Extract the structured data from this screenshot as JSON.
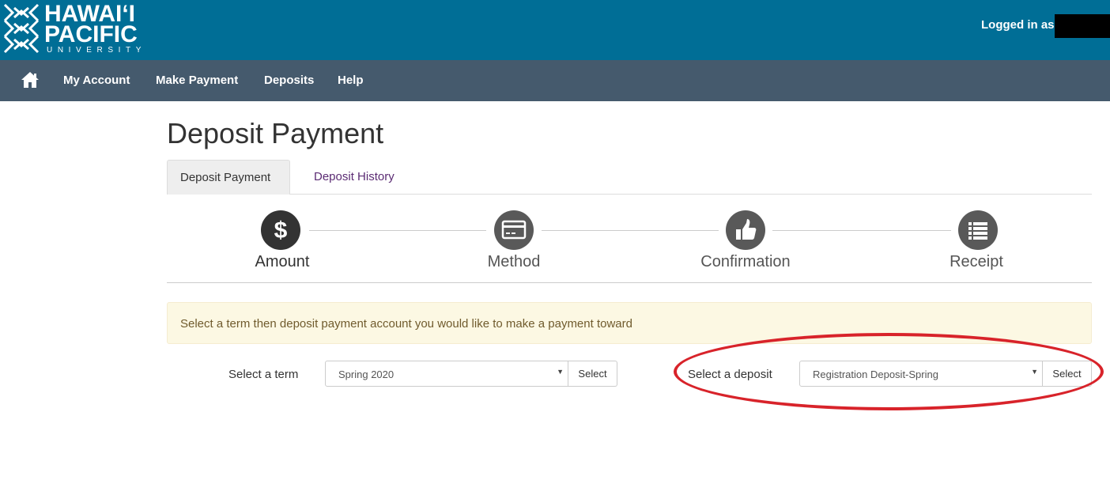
{
  "header": {
    "logo": {
      "line1": "HAWAI‘I",
      "line2": "PACIFIC",
      "line3": "UNIVERSITY"
    },
    "login_text": "Logged in as",
    "brand_color": "#006e96"
  },
  "nav": {
    "home_icon": "home-icon",
    "items": [
      {
        "label": "My Account"
      },
      {
        "label": "Make Payment"
      },
      {
        "label": "Deposits"
      },
      {
        "label": "Help"
      }
    ],
    "background": "#455a6d"
  },
  "main": {
    "title": "Deposit Payment",
    "tabs": [
      {
        "label": "Deposit Payment",
        "active": true
      },
      {
        "label": "Deposit History",
        "active": false
      }
    ],
    "steps": [
      {
        "label": "Amount",
        "icon": "dollar-icon",
        "active": true
      },
      {
        "label": "Method",
        "icon": "credit-card-icon",
        "active": false
      },
      {
        "label": "Confirmation",
        "icon": "thumbs-up-icon",
        "active": false
      },
      {
        "label": "Receipt",
        "icon": "list-icon",
        "active": false
      }
    ],
    "alert": "Select a term then deposit payment account you would like to make a payment toward",
    "term": {
      "label": "Select a term",
      "value": "Spring 2020",
      "button": "Select"
    },
    "deposit": {
      "label": "Select a deposit",
      "value": "Registration Deposit-Spring",
      "button": "Select"
    },
    "annotation_color": "#d8232a"
  }
}
